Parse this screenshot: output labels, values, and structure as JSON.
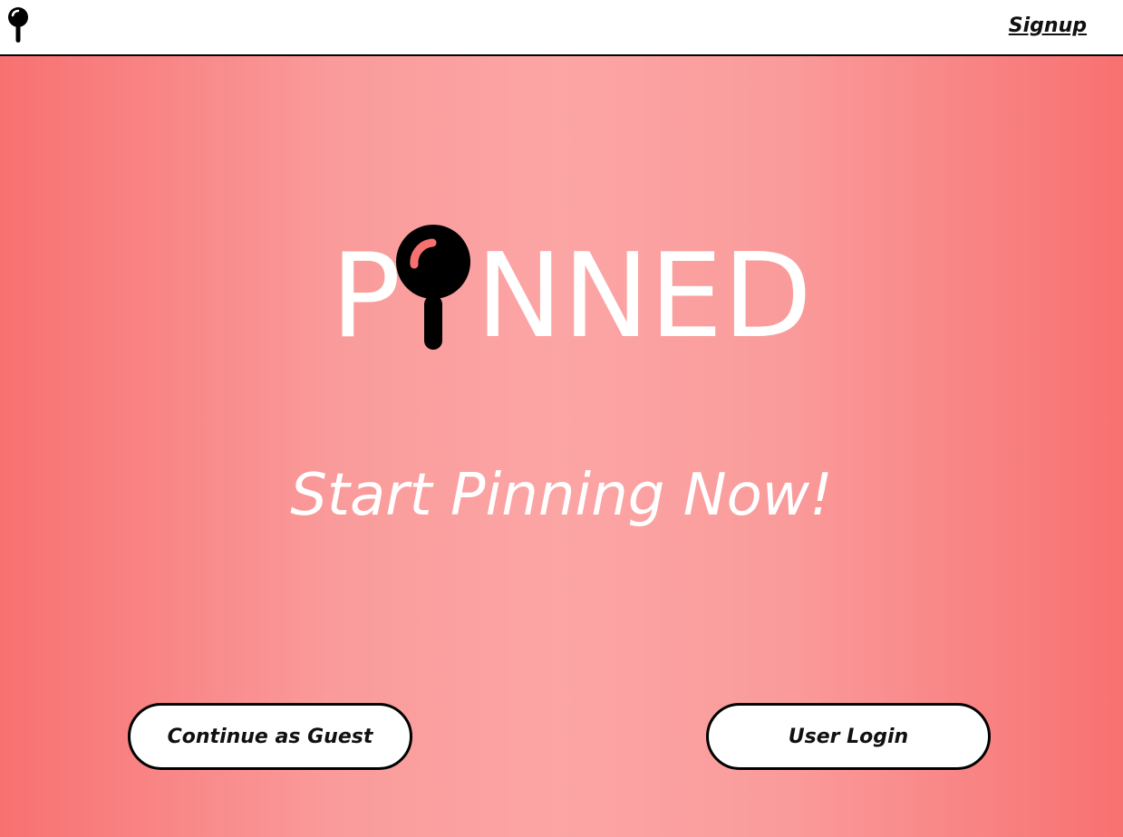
{
  "navbar": {
    "logo_icon": "pin-icon",
    "signup_label": "Signup"
  },
  "hero": {
    "logo": {
      "text": "PINNED",
      "letter_before_pin": "P",
      "pin_icon": "pin-icon",
      "letters_after_pin": "NNED"
    },
    "tagline": "Start Pinning Now!",
    "guest_button_label": "Continue as Guest",
    "login_button_label": "User Login"
  },
  "colors": {
    "gradient_edge": "#f87171",
    "gradient_center": "#fca5a5",
    "pin_highlight": "#f87171",
    "text_white": "#ffffff",
    "text_dark": "#111111"
  }
}
